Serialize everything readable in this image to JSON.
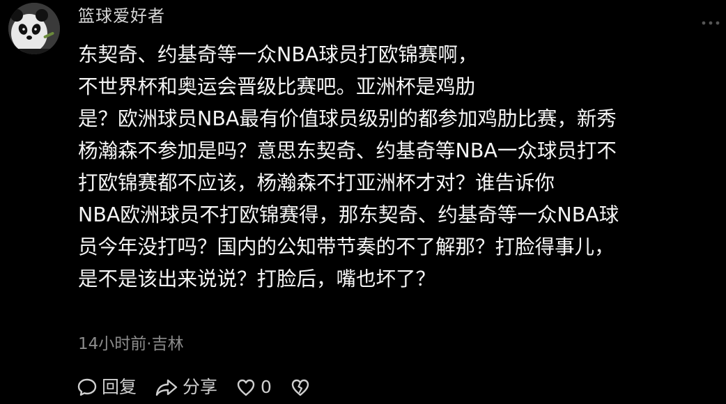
{
  "comment": {
    "username": "篮球爱好者",
    "lines": [
      "东契奇、约基奇等一众NBA球员打欧锦赛啊，",
      "不世界杯和奥运会晋级比赛吧。亚洲杯是鸡肋",
      "是？欧洲球员NBA最有价值球员级别的都参加鸡肋比赛，新秀",
      "杨瀚森不参加是吗？意思东契奇、约基奇等NBA一众球员打不",
      "打欧锦赛都不应该，杨瀚森不打亚洲杯才对？谁告诉你",
      "NBA欧洲球员不打欧锦赛得，那东契奇、约基奇等一众NBA球",
      "员今年没打吗？国内的公知带节奏的不了解那？打脸得事儿，",
      "是不是该出来说说？打脸后，嘴也坏了？"
    ],
    "time": "14小时前",
    "separator": "·",
    "location": "吉林"
  },
  "actions": {
    "reply_label": "回复",
    "share_label": "分享",
    "like_count": "0"
  },
  "icons": {
    "avatar": "panda-avatar-icon",
    "more": "more-dots-icon",
    "reply": "comment-bubble-icon",
    "share": "share-arrow-icon",
    "like": "heart-icon",
    "dislike": "broken-heart-icon"
  },
  "colors": {
    "background": "#000000",
    "text": "#f5f5f5",
    "meta": "#8c8c8c",
    "icon": "#cfcfcf"
  }
}
